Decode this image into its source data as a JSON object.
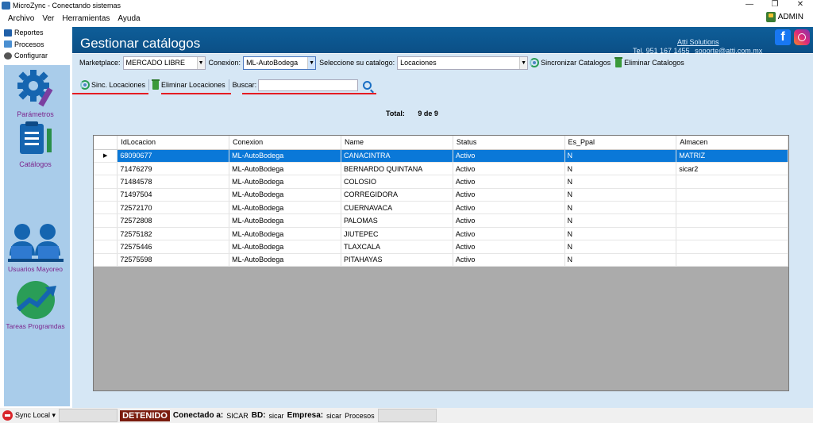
{
  "window": {
    "title": "MicroZync - Conectando sistemas"
  },
  "menu": [
    "Archivo",
    "Ver",
    "Herramientas",
    "Ayuda"
  ],
  "user": {
    "name": "ADMIN"
  },
  "sidebar": {
    "menu": [
      "Reportes",
      "Procesos",
      "Configurar"
    ],
    "items": [
      "Parámetros",
      "Catálogos",
      "Usuarios Mayoreo",
      "Tareas Programdas"
    ]
  },
  "header": {
    "title": "Gestionar catálogos",
    "company": "Atti Solutions",
    "phone": "Tel. 951 167 1455",
    "email": "soporte@atti.com.mx"
  },
  "filters": {
    "marketplace_label": "Marketplace:",
    "marketplace_value": "MERCADO LIBRE",
    "conexion_label": "Conexion:",
    "conexion_value": "ML-AutoBodega",
    "catalogo_label": "Seleccione su catalogo:",
    "catalogo_value": "Locaciones",
    "sync_catalogs": "Sincronizar Catalogos",
    "delete_catalogs": "Eliminar Catalogos"
  },
  "actions": {
    "sync_locations": "Sinc. Locaciones",
    "delete_locations": "Eliminar Locaciones",
    "search_label": "Buscar:",
    "search_value": ""
  },
  "summary": {
    "total_label": "Total:",
    "total_value": "9 de 9"
  },
  "table": {
    "columns": [
      "IdLocacion",
      "Conexion",
      "Name",
      "Status",
      "Es_Ppal",
      "Almacen"
    ],
    "rows": [
      [
        "68090677",
        "ML-AutoBodega",
        "CANACINTRA",
        "Activo",
        "N",
        "MATRIZ"
      ],
      [
        "71476279",
        "ML-AutoBodega",
        "BERNARDO QUINTANA",
        "Activo",
        "N",
        "sicar2"
      ],
      [
        "71484578",
        "ML-AutoBodega",
        "COLOSIO",
        "Activo",
        "N",
        ""
      ],
      [
        "71497504",
        "ML-AutoBodega",
        "CORREGIDORA",
        "Activo",
        "N",
        ""
      ],
      [
        "72572170",
        "ML-AutoBodega",
        "CUERNAVACA",
        "Activo",
        "N",
        ""
      ],
      [
        "72572808",
        "ML-AutoBodega",
        "PALOMAS",
        "Activo",
        "N",
        ""
      ],
      [
        "72575182",
        "ML-AutoBodega",
        "JIUTEPEC",
        "Activo",
        "N",
        ""
      ],
      [
        "72575446",
        "ML-AutoBodega",
        "TLAXCALA",
        "Activo",
        "N",
        ""
      ],
      [
        "72575598",
        "ML-AutoBodega",
        "PITAHAYAS",
        "Activo",
        "N",
        ""
      ]
    ],
    "selected_row": 0
  },
  "status": {
    "sync": "Sync Local",
    "state": "DETENIDO",
    "connected_label": "Conectado a:",
    "connected_value": "SICAR",
    "bd_label": "BD:",
    "bd_value": "sicar",
    "empresa_label": "Empresa:",
    "empresa_value": "sicar",
    "procesos": "Procesos"
  },
  "colors": {
    "header": "#0e5e99",
    "sidebar": "#a9ccea",
    "selection": "#0a78d8",
    "state": "#7b1c0e",
    "underline": "#e51c23"
  }
}
